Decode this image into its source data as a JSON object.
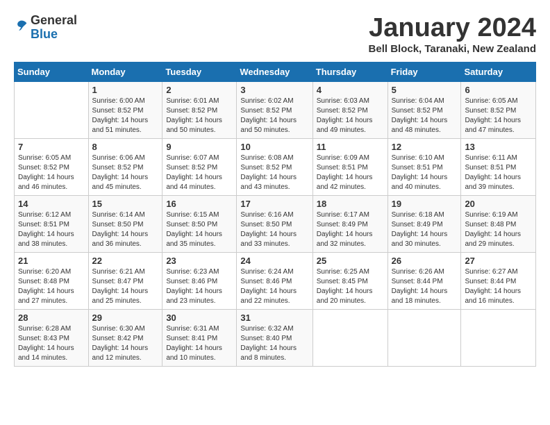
{
  "logo": {
    "general": "General",
    "blue": "Blue"
  },
  "title": "January 2024",
  "location": "Bell Block, Taranaki, New Zealand",
  "weekdays": [
    "Sunday",
    "Monday",
    "Tuesday",
    "Wednesday",
    "Thursday",
    "Friday",
    "Saturday"
  ],
  "weeks": [
    [
      {
        "day": "",
        "info": ""
      },
      {
        "day": "1",
        "info": "Sunrise: 6:00 AM\nSunset: 8:52 PM\nDaylight: 14 hours\nand 51 minutes."
      },
      {
        "day": "2",
        "info": "Sunrise: 6:01 AM\nSunset: 8:52 PM\nDaylight: 14 hours\nand 50 minutes."
      },
      {
        "day": "3",
        "info": "Sunrise: 6:02 AM\nSunset: 8:52 PM\nDaylight: 14 hours\nand 50 minutes."
      },
      {
        "day": "4",
        "info": "Sunrise: 6:03 AM\nSunset: 8:52 PM\nDaylight: 14 hours\nand 49 minutes."
      },
      {
        "day": "5",
        "info": "Sunrise: 6:04 AM\nSunset: 8:52 PM\nDaylight: 14 hours\nand 48 minutes."
      },
      {
        "day": "6",
        "info": "Sunrise: 6:05 AM\nSunset: 8:52 PM\nDaylight: 14 hours\nand 47 minutes."
      }
    ],
    [
      {
        "day": "7",
        "info": "Sunrise: 6:05 AM\nSunset: 8:52 PM\nDaylight: 14 hours\nand 46 minutes."
      },
      {
        "day": "8",
        "info": "Sunrise: 6:06 AM\nSunset: 8:52 PM\nDaylight: 14 hours\nand 45 minutes."
      },
      {
        "day": "9",
        "info": "Sunrise: 6:07 AM\nSunset: 8:52 PM\nDaylight: 14 hours\nand 44 minutes."
      },
      {
        "day": "10",
        "info": "Sunrise: 6:08 AM\nSunset: 8:52 PM\nDaylight: 14 hours\nand 43 minutes."
      },
      {
        "day": "11",
        "info": "Sunrise: 6:09 AM\nSunset: 8:51 PM\nDaylight: 14 hours\nand 42 minutes."
      },
      {
        "day": "12",
        "info": "Sunrise: 6:10 AM\nSunset: 8:51 PM\nDaylight: 14 hours\nand 40 minutes."
      },
      {
        "day": "13",
        "info": "Sunrise: 6:11 AM\nSunset: 8:51 PM\nDaylight: 14 hours\nand 39 minutes."
      }
    ],
    [
      {
        "day": "14",
        "info": "Sunrise: 6:12 AM\nSunset: 8:51 PM\nDaylight: 14 hours\nand 38 minutes."
      },
      {
        "day": "15",
        "info": "Sunrise: 6:14 AM\nSunset: 8:50 PM\nDaylight: 14 hours\nand 36 minutes."
      },
      {
        "day": "16",
        "info": "Sunrise: 6:15 AM\nSunset: 8:50 PM\nDaylight: 14 hours\nand 35 minutes."
      },
      {
        "day": "17",
        "info": "Sunrise: 6:16 AM\nSunset: 8:50 PM\nDaylight: 14 hours\nand 33 minutes."
      },
      {
        "day": "18",
        "info": "Sunrise: 6:17 AM\nSunset: 8:49 PM\nDaylight: 14 hours\nand 32 minutes."
      },
      {
        "day": "19",
        "info": "Sunrise: 6:18 AM\nSunset: 8:49 PM\nDaylight: 14 hours\nand 30 minutes."
      },
      {
        "day": "20",
        "info": "Sunrise: 6:19 AM\nSunset: 8:48 PM\nDaylight: 14 hours\nand 29 minutes."
      }
    ],
    [
      {
        "day": "21",
        "info": "Sunrise: 6:20 AM\nSunset: 8:48 PM\nDaylight: 14 hours\nand 27 minutes."
      },
      {
        "day": "22",
        "info": "Sunrise: 6:21 AM\nSunset: 8:47 PM\nDaylight: 14 hours\nand 25 minutes."
      },
      {
        "day": "23",
        "info": "Sunrise: 6:23 AM\nSunset: 8:46 PM\nDaylight: 14 hours\nand 23 minutes."
      },
      {
        "day": "24",
        "info": "Sunrise: 6:24 AM\nSunset: 8:46 PM\nDaylight: 14 hours\nand 22 minutes."
      },
      {
        "day": "25",
        "info": "Sunrise: 6:25 AM\nSunset: 8:45 PM\nDaylight: 14 hours\nand 20 minutes."
      },
      {
        "day": "26",
        "info": "Sunrise: 6:26 AM\nSunset: 8:44 PM\nDaylight: 14 hours\nand 18 minutes."
      },
      {
        "day": "27",
        "info": "Sunrise: 6:27 AM\nSunset: 8:44 PM\nDaylight: 14 hours\nand 16 minutes."
      }
    ],
    [
      {
        "day": "28",
        "info": "Sunrise: 6:28 AM\nSunset: 8:43 PM\nDaylight: 14 hours\nand 14 minutes."
      },
      {
        "day": "29",
        "info": "Sunrise: 6:30 AM\nSunset: 8:42 PM\nDaylight: 14 hours\nand 12 minutes."
      },
      {
        "day": "30",
        "info": "Sunrise: 6:31 AM\nSunset: 8:41 PM\nDaylight: 14 hours\nand 10 minutes."
      },
      {
        "day": "31",
        "info": "Sunrise: 6:32 AM\nSunset: 8:40 PM\nDaylight: 14 hours\nand 8 minutes."
      },
      {
        "day": "",
        "info": ""
      },
      {
        "day": "",
        "info": ""
      },
      {
        "day": "",
        "info": ""
      }
    ]
  ]
}
